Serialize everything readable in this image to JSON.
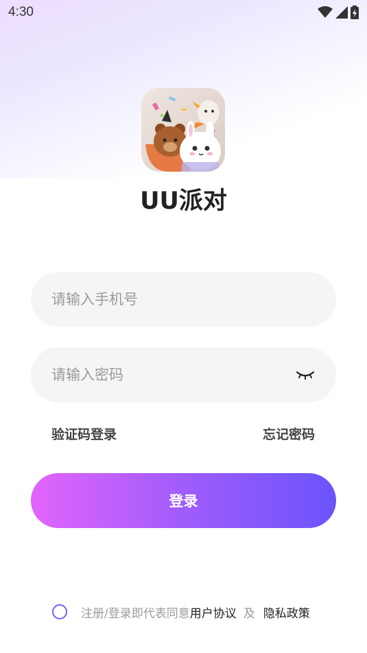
{
  "status_bar": {
    "time": "4:30"
  },
  "app": {
    "name": "UU派对"
  },
  "form": {
    "phone_placeholder": "请输入手机号",
    "password_placeholder": "请输入密码"
  },
  "links": {
    "sms_login": "验证码登录",
    "forgot_password": "忘记密码"
  },
  "login_button": {
    "label": "登录"
  },
  "agreement": {
    "prefix": "注册/登录即代表同意",
    "user_agreement": "用户协议",
    "and": "及",
    "privacy_policy": "隐私政策"
  },
  "colors": {
    "accent_start": "#e264fb",
    "accent_end": "#6a54fb",
    "radio_border": "#7b5cf5"
  }
}
